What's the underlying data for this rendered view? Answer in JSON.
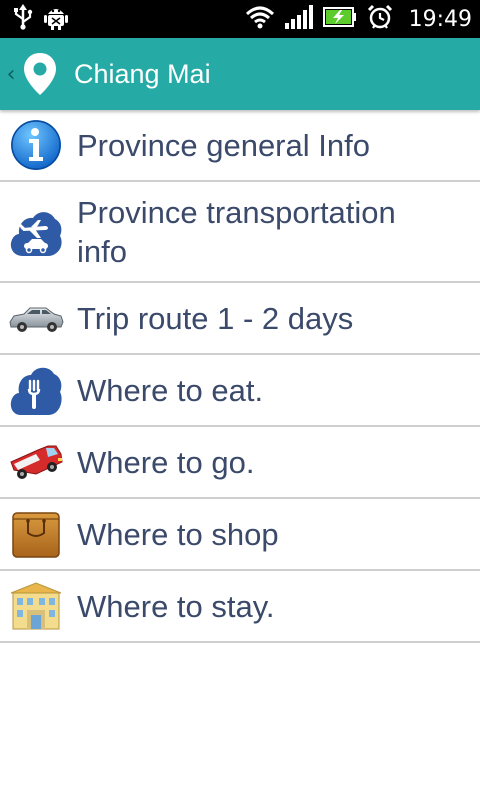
{
  "status_bar": {
    "time": "19:49",
    "icons": [
      "usb-icon",
      "android-debug-icon",
      "wifi-icon",
      "signal-icon",
      "battery-charging-icon",
      "alarm-clock-icon"
    ]
  },
  "action_bar": {
    "title": "Chiang Mai",
    "up_glyph": "‹",
    "icon": "location-pin-icon",
    "color": "#25aaa5"
  },
  "menu": {
    "items": [
      {
        "label": "Province general Info",
        "icon": "info-icon"
      },
      {
        "label": "Province transportation info",
        "icon": "transport-cloud-icon"
      },
      {
        "label": "Trip route 1 - 2 days",
        "icon": "car-icon"
      },
      {
        "label": "Where to eat.",
        "icon": "fork-cloud-icon"
      },
      {
        "label": "Where to go.",
        "icon": "pickup-truck-icon"
      },
      {
        "label": "Where to shop",
        "icon": "shopping-bag-icon"
      },
      {
        "label": "Where to stay.",
        "icon": "hotel-icon"
      }
    ]
  },
  "colors": {
    "label_text": "#3b4a6b",
    "divider": "#cfcfcf"
  }
}
